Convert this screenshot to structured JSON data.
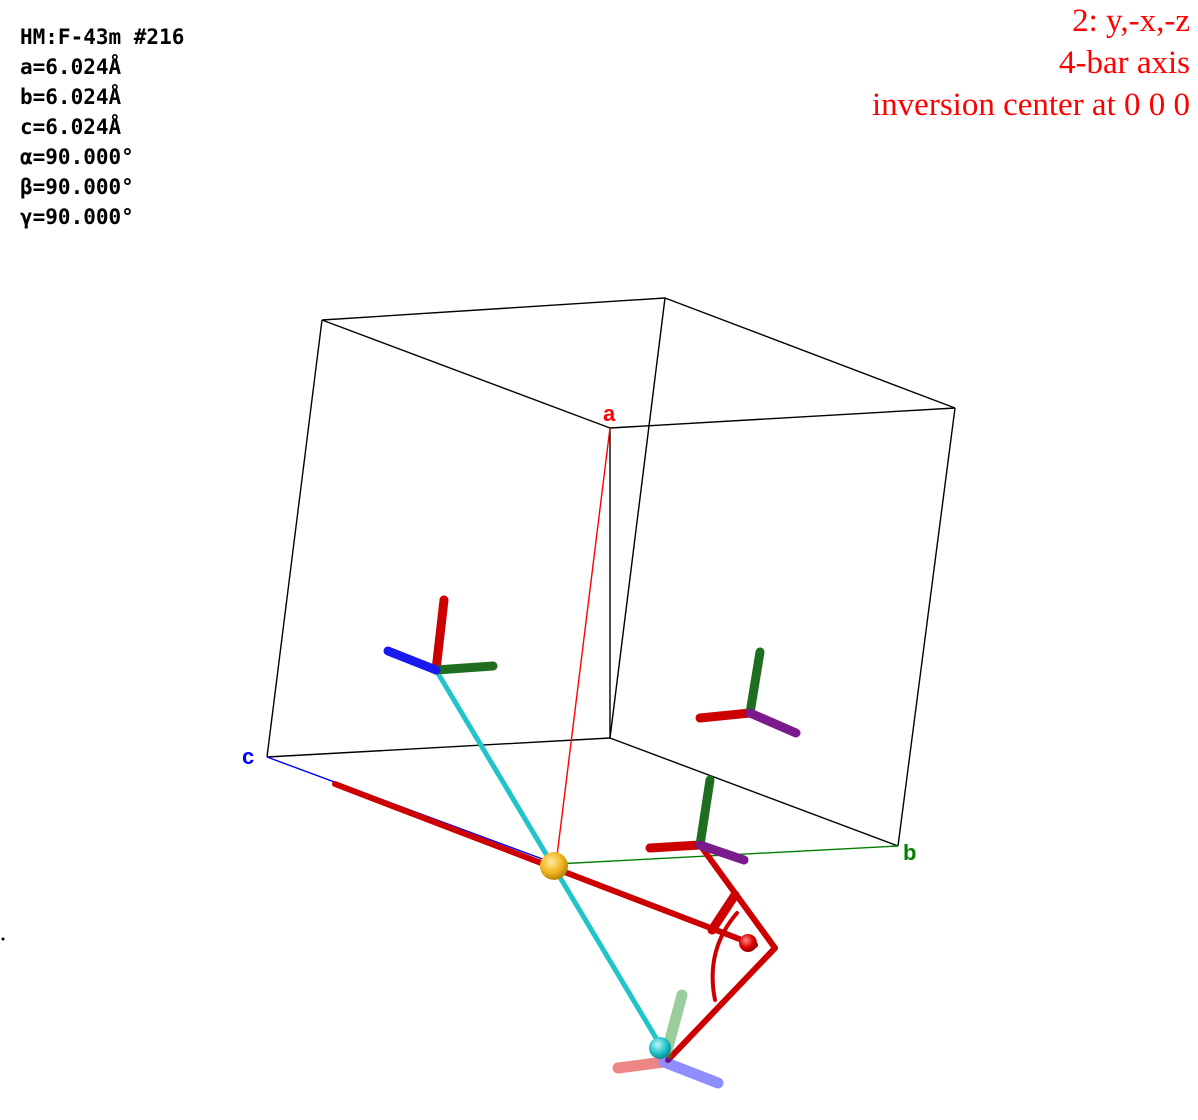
{
  "cell": {
    "space_group": "HM:F-43m #216",
    "a": "a=6.024Å",
    "b": "b=6.024Å",
    "c": "c=6.024Å",
    "alpha": "α=90.000°",
    "beta": "β=90.000°",
    "gamma": "γ=90.000°"
  },
  "operation": {
    "line1": "2: y,-x,-z",
    "line2": "4-bar axis",
    "line3": "inversion center at 0 0 0"
  },
  "axes": {
    "a_label": "a",
    "b_label": "b",
    "c_label": "c",
    "a_color": "#ff0000",
    "b_color": "#008000",
    "c_color": "#0000ff"
  },
  "colors": {
    "op_text": "#ff0000",
    "cell_edges": "#000000",
    "symmetry_element": "#cc0000",
    "connector": "#22c4cc",
    "inversion_center": "#f2b61e"
  }
}
